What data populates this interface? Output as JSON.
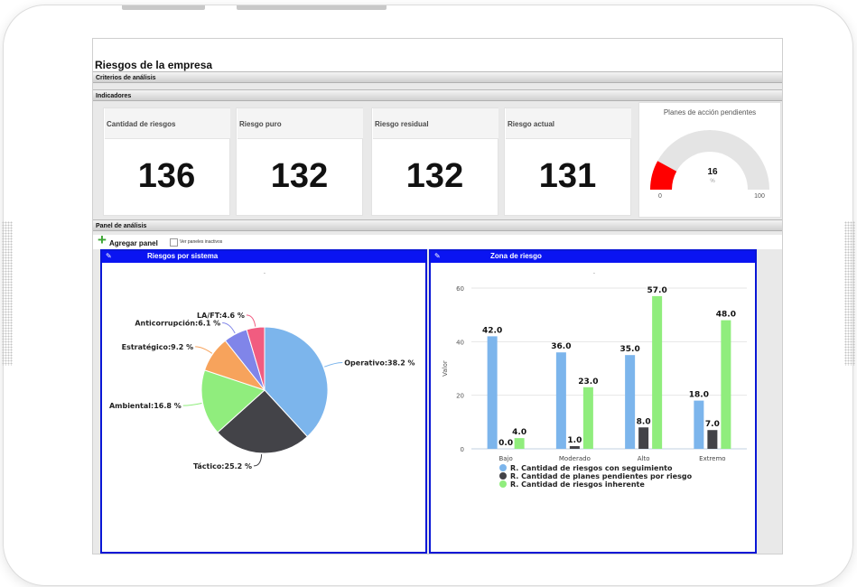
{
  "page": {
    "title": "Riesgos de la empresa",
    "sections": {
      "criteria": "Criterios de análisis",
      "indicators": "Indicadores",
      "analysis": "Panel de análisis"
    }
  },
  "kpis": [
    {
      "label": "Cantidad de riesgos",
      "value": "136"
    },
    {
      "label": "Riesgo puro",
      "value": "132"
    },
    {
      "label": "Riesgo residual",
      "value": "132"
    },
    {
      "label": "Riesgo actual",
      "value": "131"
    }
  ],
  "gauge": {
    "title": "Planes de acción pendientes",
    "value": 16,
    "value_label": "16",
    "unit": "%",
    "min_label": "0",
    "max_label": "100",
    "min": 0,
    "max": 100,
    "fill_color": "#ff0000",
    "track_color": "#e4e4e4"
  },
  "toolbar": {
    "add_panel_label": "Agregar panel",
    "inactive_label": "Ver paneles inactivos"
  },
  "panels": {
    "pie_title": "Riesgos por sistema",
    "bar_title": "Zona de riesgo",
    "header_color": "#0a14f2"
  },
  "chart_data": [
    {
      "type": "pie",
      "title": "",
      "slices": [
        {
          "label": "Operativo:38.2 %",
          "value": 38.2,
          "color": "#7cb5ec"
        },
        {
          "label": "Táctico:25.2 %",
          "value": 25.2,
          "color": "#434348"
        },
        {
          "label": "Ambiental:16.8 %",
          "value": 16.8,
          "color": "#90ed7d"
        },
        {
          "label": "Estratégico:9.2 %",
          "value": 9.2,
          "color": "#f7a35c"
        },
        {
          "label": "Anticorrupción:6.1 %",
          "value": 6.1,
          "color": "#8085e9"
        },
        {
          "label": "LA/FT:4.6 %",
          "value": 4.6,
          "color": "#f15c80"
        }
      ]
    },
    {
      "type": "bar",
      "title": "",
      "categories": [
        "Bajo",
        "Moderado",
        "Alto",
        "Extremo"
      ],
      "series": [
        {
          "name": "R. Cantidad de riesgos con seguimiento",
          "values": [
            42.0,
            36.0,
            35.0,
            18.0
          ],
          "labels": [
            "42.0",
            "36.0",
            "35.0",
            "18.0"
          ],
          "color": "#7cb5ec"
        },
        {
          "name": "R. Cantidad de planes pendientes por riesgo",
          "values": [
            0.0,
            1.0,
            8.0,
            7.0
          ],
          "labels": [
            "0.0",
            "1.0",
            "8.0",
            "7.0"
          ],
          "color": "#434348"
        },
        {
          "name": "R. Cantidad de riesgos inherente",
          "values": [
            4.0,
            23.0,
            57.0,
            48.0
          ],
          "labels": [
            "4.0",
            "23.0",
            "57.0",
            "48.0"
          ],
          "color": "#90ed7d"
        }
      ],
      "ylabel": "Valor",
      "ylim": [
        0,
        60
      ],
      "yticks": [
        "0",
        "20",
        "40",
        "60"
      ],
      "grid": true,
      "legend": "bottom"
    }
  ]
}
